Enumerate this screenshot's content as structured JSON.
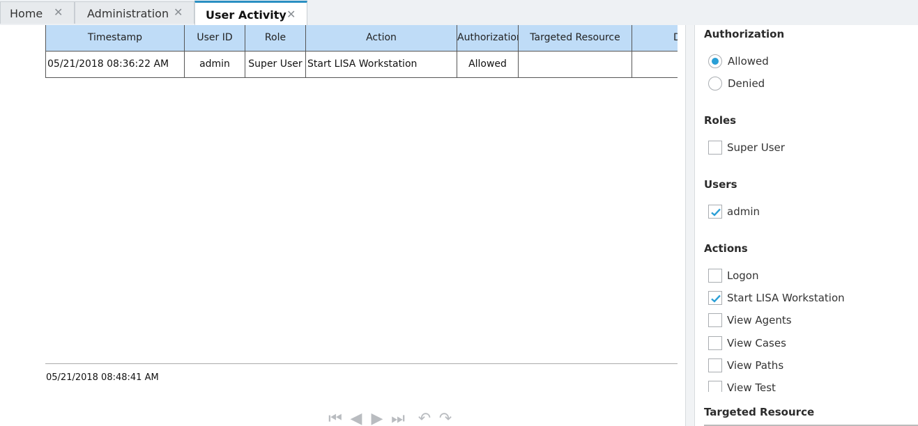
{
  "tabs": [
    {
      "label": "Home",
      "active": false
    },
    {
      "label": "Administration",
      "active": false
    },
    {
      "label": "User Activity",
      "active": true
    }
  ],
  "grid": {
    "columns": [
      "Timestamp",
      "User ID",
      "Role",
      "Action",
      "Authorization",
      "Targeted Resource",
      "D"
    ],
    "rows": [
      [
        "05/21/2018 08:36:22 AM",
        "admin",
        "Super User",
        "Start LISA Workstation",
        "Allowed",
        "",
        ""
      ]
    ]
  },
  "footer": {
    "timestamp": "05/21/2018 08:48:41 AM"
  },
  "pager": {
    "first_icon": "first-page-icon",
    "prev_icon": "previous-page-icon",
    "next_icon": "next-page-icon",
    "last_icon": "last-page-icon",
    "undo_icon": "undo-icon",
    "redo_icon": "redo-icon"
  },
  "filters": {
    "authorization": {
      "title": "Authorization",
      "options": [
        {
          "label": "Allowed",
          "selected": true
        },
        {
          "label": "Denied",
          "selected": false
        }
      ]
    },
    "roles": {
      "title": "Roles",
      "options": [
        {
          "label": "Super User",
          "checked": false
        }
      ]
    },
    "users": {
      "title": "Users",
      "options": [
        {
          "label": "admin",
          "checked": true
        }
      ]
    },
    "actions": {
      "title": "Actions",
      "options": [
        {
          "label": "Logon",
          "checked": false
        },
        {
          "label": "Start LISA Workstation",
          "checked": true
        },
        {
          "label": "View Agents",
          "checked": false
        },
        {
          "label": "View Cases",
          "checked": false
        },
        {
          "label": "View Paths",
          "checked": false
        },
        {
          "label": "View Test",
          "checked": false
        }
      ]
    },
    "targeted_resource": {
      "title": "Targeted Resource"
    }
  },
  "colors": {
    "header_bg": "#bfdcf7",
    "accent": "#2a9fd6",
    "active_tab_border": "#2a8fc2"
  }
}
